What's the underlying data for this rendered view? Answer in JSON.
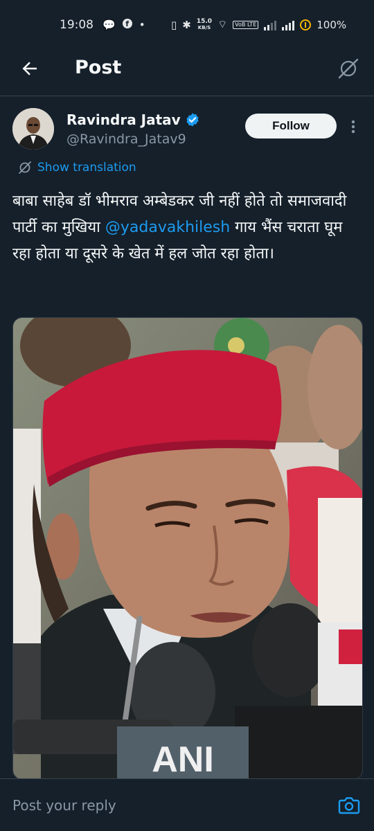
{
  "status_bar": {
    "time": "19:08",
    "net_speed_value": "15.0",
    "net_speed_unit": "KB/S",
    "volte": "VoB LTE",
    "battery": "100%"
  },
  "header": {
    "title": "Post"
  },
  "post": {
    "author_name": "Ravindra Jatav",
    "author_handle": "@Ravindra_Jatav9",
    "follow_label": "Follow",
    "translate_label": "Show translation",
    "text_part1": "बाबा साहेब डॉ भीमराव अम्बेडकर जी नहीं होते तो समाजवादी पार्टी का मुखिया ",
    "mention": "@yadavakhilesh",
    "text_part2": " गाय भैंस चराता घूम रहा होता या दूसरे के खेत में हल जोत रहा होता।",
    "image_caption": "ANI"
  },
  "reply": {
    "placeholder": "Post your reply"
  },
  "colors": {
    "accent": "#1d9bf0",
    "background": "#15202b",
    "muted": "#8b98a5"
  },
  "icons": [
    "back-arrow-icon",
    "grok-icon",
    "verified-icon",
    "more-icon",
    "translate-icon",
    "camera-icon"
  ]
}
